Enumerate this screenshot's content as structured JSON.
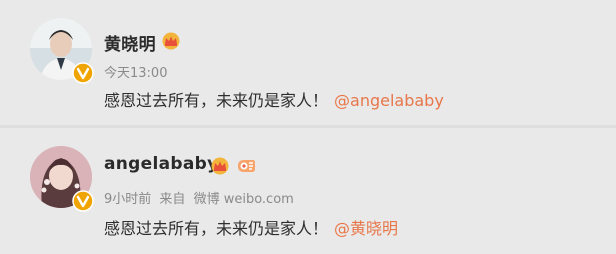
{
  "posts": [
    {
      "username": "黄晓明",
      "time": "今天13:00",
      "text": "感恩过去所有，未来仍是家人！",
      "mention": "@angelababy"
    },
    {
      "username": "angelababy",
      "time": "9小时前",
      "source_prefix": "来自",
      "source": "微博 weibo.com",
      "text": "感恩过去所有，未来仍是家人！",
      "mention": "@黄晓明"
    }
  ],
  "colors": {
    "background": "#e9e9e9",
    "mention": "#e8774a",
    "meta": "#8a8a8a",
    "verified_badge": "#f0a400"
  },
  "icons": [
    "verified-badge-icon",
    "vip-crown-icon",
    "fan-badge-icon"
  ]
}
